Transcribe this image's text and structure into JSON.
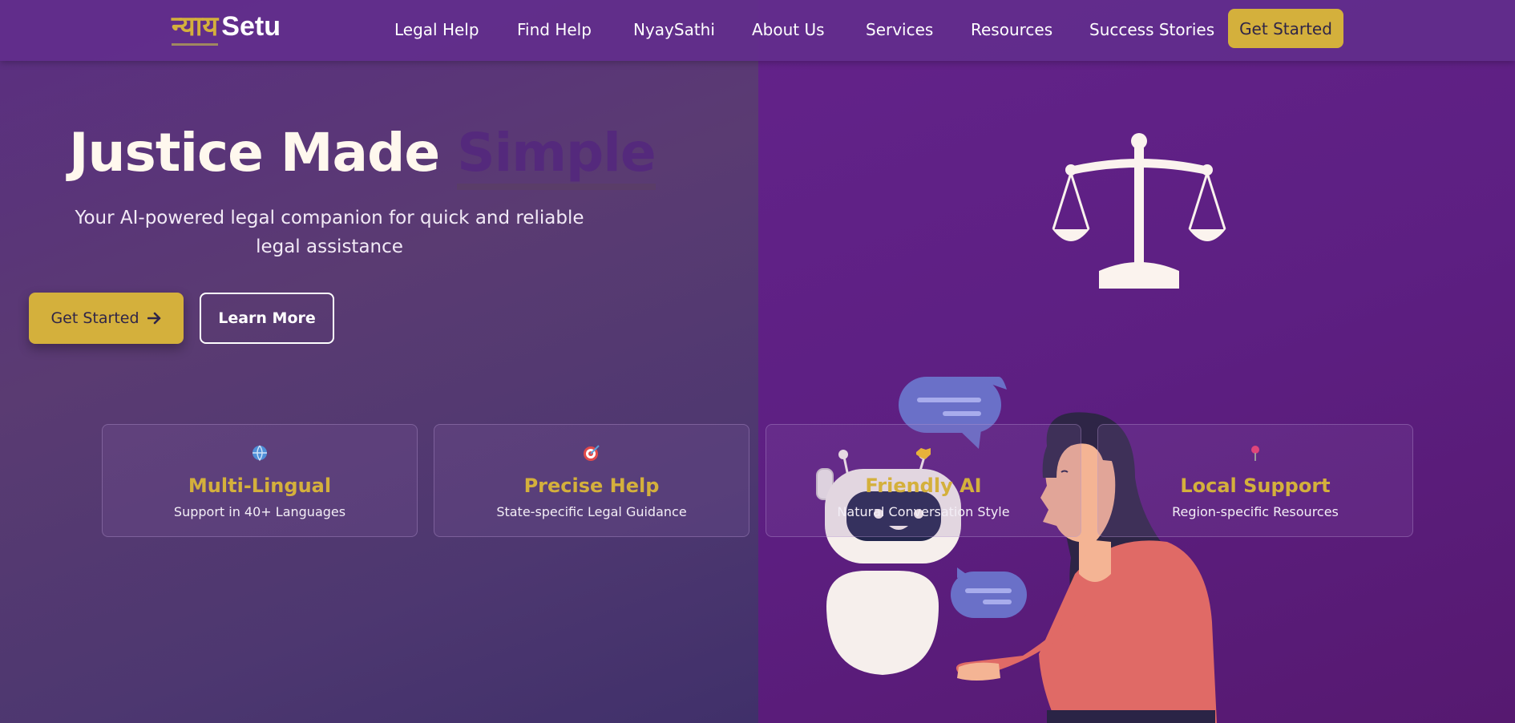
{
  "brand": {
    "logo_hindi": "न्याय",
    "logo_latin": "Setu"
  },
  "nav": {
    "items": [
      {
        "label": "Legal Help"
      },
      {
        "label": "Find Help"
      },
      {
        "label": "NyaySathi"
      },
      {
        "label": "About Us"
      },
      {
        "label": "Services"
      },
      {
        "label": "Resources"
      },
      {
        "label": "Success Stories"
      }
    ],
    "cta": "Get Started"
  },
  "hero": {
    "title_main": "Justice Made ",
    "title_accent": "Simple",
    "subtitle": "Your AI-powered legal companion for quick and reliable legal assistance",
    "primary_button": "Get Started",
    "secondary_button": "Learn More"
  },
  "features": [
    {
      "icon": "globe-icon",
      "title": "Multi-Lingual",
      "text": "Support in 40+ Languages"
    },
    {
      "icon": "target-icon",
      "title": "Precise Help",
      "text": "State-specific Legal Guidance"
    },
    {
      "icon": "handshake-icon",
      "title": "Friendly AI",
      "text": "Natural Conversation Style"
    },
    {
      "icon": "location-pin-icon",
      "title": "Local Support",
      "text": "Region-specific Resources"
    }
  ],
  "colors": {
    "accent_gold": "#d4b03c",
    "purple_dark": "#5d1f82",
    "navbar": "#622e8c"
  }
}
